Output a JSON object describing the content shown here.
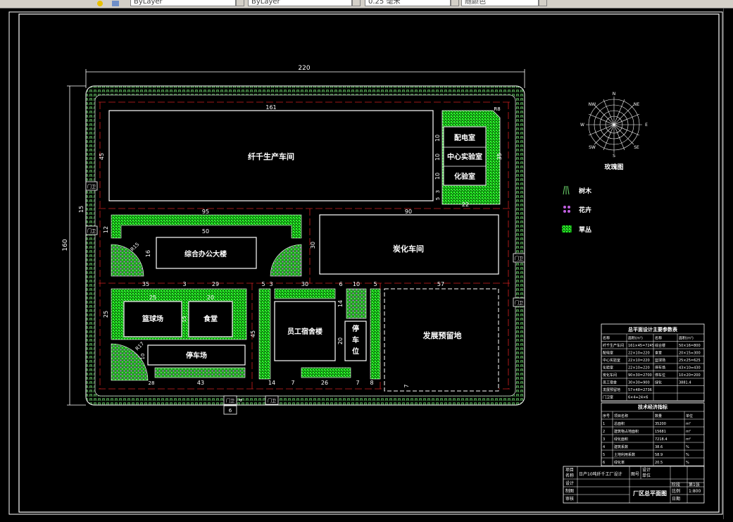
{
  "toolbar": {
    "layer_combo_1": "ByLayer",
    "layer_combo_2": "ByLayer",
    "lineweight_combo": "0.25 毫米",
    "color_combo": "随颜色"
  },
  "plan": {
    "dims": {
      "overall_width": "220",
      "overall_height": "160",
      "top_bldg_width": "161",
      "top_bldg_height": "45",
      "bottom_gap": "6",
      "left_gap": "15",
      "row2_left": "95",
      "row2_right": "90",
      "office_w": "50",
      "office_h": "16",
      "left_12": "12",
      "r15": "R15",
      "left_30": "30",
      "row3_35": "35",
      "row3_3a": "3",
      "row3_29": "29",
      "row3_5a": "5",
      "row3_3b": "3",
      "row3_30": "30",
      "row3_6": "6",
      "row3_10": "10",
      "row3_5b": "5",
      "row3_57": "57",
      "left_25": "25",
      "bb_15": "15",
      "r17": "R17",
      "left_10": "10",
      "bottom_28": "28",
      "bottom_43": "43",
      "mid_25": "25",
      "mid_20": "20",
      "mid_45": "45",
      "dorm_20": "20",
      "r2_14": "14",
      "b_14": "14",
      "b_7a": "7",
      "b_26": "26",
      "b_7b": "7",
      "b_8": "8",
      "right_7": "7",
      "right_10a": "10",
      "right_10b": "10",
      "right_10c": "10",
      "right_5": "5",
      "right_3": "3",
      "right_22": "22",
      "right_35": "35",
      "right_r8": "R8"
    },
    "buildings": {
      "fiber_workshop": "纤千生产车间",
      "power_room": "配电室",
      "central_lab": "中心实验室",
      "chem_room": "化验室",
      "office": "综合办公大楼",
      "carbon_workshop": "炭化车间",
      "basketball": "篮球场",
      "canteen": "食堂",
      "parking": "停车场",
      "dorm": "员工宿舍楼",
      "parking2": "停车位",
      "reserve": "发展预留地"
    },
    "gates": [
      "门卫",
      "门卫",
      "门卫",
      "门卫",
      "门卫",
      "门卫"
    ],
    "compass_title": "玫瑰图",
    "compass_dirs": [
      "N",
      "NE",
      "E",
      "SE",
      "S",
      "SW",
      "W",
      "NW"
    ]
  },
  "legend": [
    {
      "label": "树木",
      "icon": "tree-icon"
    },
    {
      "label": "花卉",
      "icon": "flower-icon"
    },
    {
      "label": "草丛",
      "icon": "grass-icon"
    }
  ],
  "area_table": {
    "title": "总平面设计主要参数表",
    "headers": [
      "名称",
      "面积(m²)",
      "名称",
      "面积(m²)"
    ],
    "rows": [
      [
        "纤千生产车间",
        "161×45=7245",
        "综合楼",
        "50×16=800"
      ],
      [
        "配电室",
        "22×10=220",
        "食堂",
        "20×15=300"
      ],
      [
        "中心实验室",
        "22×10=220",
        "篮球场",
        "25×25=625"
      ],
      [
        "化验室",
        "22×10=220",
        "停车场",
        "43×10=430"
      ],
      [
        "炭化车间",
        "90×30=2700",
        "停车位",
        "10×20=200"
      ],
      [
        "员工宿舍",
        "30×30=900",
        "绿化",
        "3881.4"
      ],
      [
        "发展预留地",
        "57×48=2736",
        "",
        ""
      ],
      [
        "门卫室",
        "6×4=24×6",
        "",
        ""
      ]
    ]
  },
  "tech_table": {
    "title": "技术经济指标",
    "headers": [
      "序号",
      "项目名称",
      "数量",
      "单位"
    ],
    "rows": [
      [
        "1",
        "总面积",
        "35200",
        "m²"
      ],
      [
        "2",
        "建筑物占地面积",
        "15681",
        "m²"
      ],
      [
        "3",
        "绿化面积",
        "7218.4",
        "m²"
      ],
      [
        "4",
        "建筑系数",
        "38.6",
        "%"
      ],
      [
        "5",
        "土地利用系数",
        "58.9",
        "%"
      ],
      [
        "6",
        "绿化率",
        "20.5",
        "%"
      ]
    ]
  },
  "title_block": {
    "project_label": "项目名称",
    "project_name": "日产10吨纤千工厂设计",
    "figure_label": "图号",
    "design_label": "设计",
    "drawing_label": "制图",
    "check_label": "审核",
    "design_unit_label": "设计单位",
    "title": "厂区总平面图",
    "scale_label": "比例",
    "scale_value": "1:800",
    "sheet_label": "第1张",
    "date_label": "日期",
    "stage_label": "阶段"
  }
}
